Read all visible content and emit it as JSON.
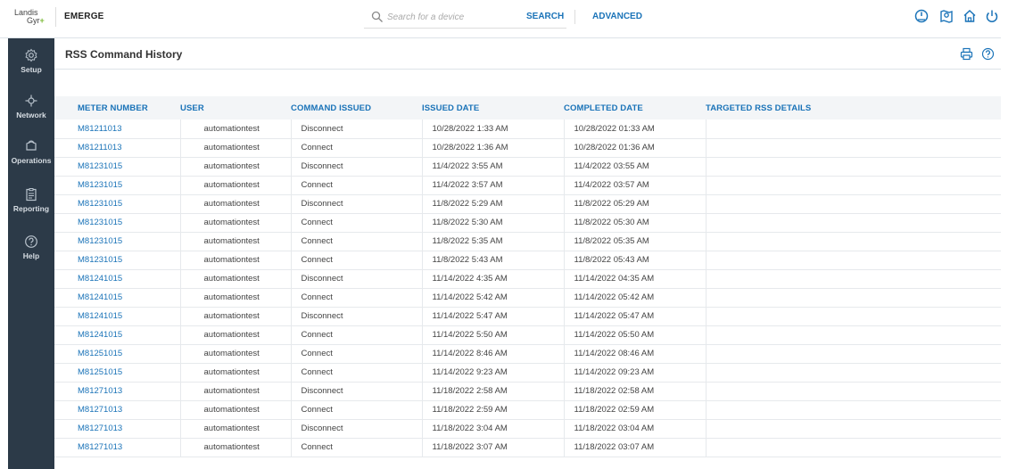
{
  "brand": {
    "logo_line1": "Landis",
    "logo_line2": "Gyr",
    "logo_plus": "+",
    "app_name": "EMERGE"
  },
  "search": {
    "placeholder": "Search for a device",
    "value": "",
    "search_label": "SEARCH",
    "advanced_label": "ADVANCED"
  },
  "top_icons": [
    "dashboard-gauge-icon",
    "map-pin-icon",
    "home-icon",
    "power-icon"
  ],
  "sidebar": {
    "items": [
      {
        "label": "Setup",
        "icon": "gear-icon"
      },
      {
        "label": "Network",
        "icon": "network-icon"
      },
      {
        "label": "Operations",
        "icon": "operations-icon"
      },
      {
        "label": "Reporting",
        "icon": "clipboard-icon"
      },
      {
        "label": "Help",
        "icon": "help-icon"
      }
    ]
  },
  "page": {
    "title": "RSS Command History",
    "actions": [
      "print-icon",
      "help-icon"
    ]
  },
  "table": {
    "headers": [
      "METER NUMBER",
      "USER",
      "COMMAND ISSUED",
      "ISSUED DATE",
      "COMPLETED DATE",
      "TARGETED RSS DETAILS"
    ],
    "rows": [
      [
        "M81211013",
        "automationtest",
        "Disconnect",
        "10/28/2022 1:33 AM",
        "10/28/2022 01:33 AM",
        ""
      ],
      [
        "M81211013",
        "automationtest",
        "Connect",
        "10/28/2022 1:36 AM",
        "10/28/2022 01:36 AM",
        ""
      ],
      [
        "M81231015",
        "automationtest",
        "Disconnect",
        "11/4/2022 3:55 AM",
        "11/4/2022 03:55 AM",
        ""
      ],
      [
        "M81231015",
        "automationtest",
        "Connect",
        "11/4/2022 3:57 AM",
        "11/4/2022 03:57 AM",
        ""
      ],
      [
        "M81231015",
        "automationtest",
        "Disconnect",
        "11/8/2022 5:29 AM",
        "11/8/2022 05:29 AM",
        ""
      ],
      [
        "M81231015",
        "automationtest",
        "Connect",
        "11/8/2022 5:30 AM",
        "11/8/2022 05:30 AM",
        ""
      ],
      [
        "M81231015",
        "automationtest",
        "Connect",
        "11/8/2022 5:35 AM",
        "11/8/2022 05:35 AM",
        ""
      ],
      [
        "M81231015",
        "automationtest",
        "Connect",
        "11/8/2022 5:43 AM",
        "11/8/2022 05:43 AM",
        ""
      ],
      [
        "M81241015",
        "automationtest",
        "Disconnect",
        "11/14/2022 4:35 AM",
        "11/14/2022 04:35 AM",
        ""
      ],
      [
        "M81241015",
        "automationtest",
        "Connect",
        "11/14/2022 5:42 AM",
        "11/14/2022 05:42 AM",
        ""
      ],
      [
        "M81241015",
        "automationtest",
        "Disconnect",
        "11/14/2022 5:47 AM",
        "11/14/2022 05:47 AM",
        ""
      ],
      [
        "M81241015",
        "automationtest",
        "Connect",
        "11/14/2022 5:50 AM",
        "11/14/2022 05:50 AM",
        ""
      ],
      [
        "M81251015",
        "automationtest",
        "Connect",
        "11/14/2022 8:46 AM",
        "11/14/2022 08:46 AM",
        ""
      ],
      [
        "M81251015",
        "automationtest",
        "Connect",
        "11/14/2022 9:23 AM",
        "11/14/2022 09:23 AM",
        ""
      ],
      [
        "M81271013",
        "automationtest",
        "Disconnect",
        "11/18/2022 2:58 AM",
        "11/18/2022 02:58 AM",
        ""
      ],
      [
        "M81271013",
        "automationtest",
        "Connect",
        "11/18/2022 2:59 AM",
        "11/18/2022 02:59 AM",
        ""
      ],
      [
        "M81271013",
        "automationtest",
        "Disconnect",
        "11/18/2022 3:04 AM",
        "11/18/2022 03:04 AM",
        ""
      ],
      [
        "M81271013",
        "automationtest",
        "Connect",
        "11/18/2022 3:07 AM",
        "11/18/2022 03:07 AM",
        ""
      ]
    ]
  },
  "colors": {
    "accent": "#1a73b8",
    "sidebar_bg": "#2c3a48",
    "logo_plus": "#7dbb3a",
    "header_row_bg": "#f3f5f7"
  }
}
